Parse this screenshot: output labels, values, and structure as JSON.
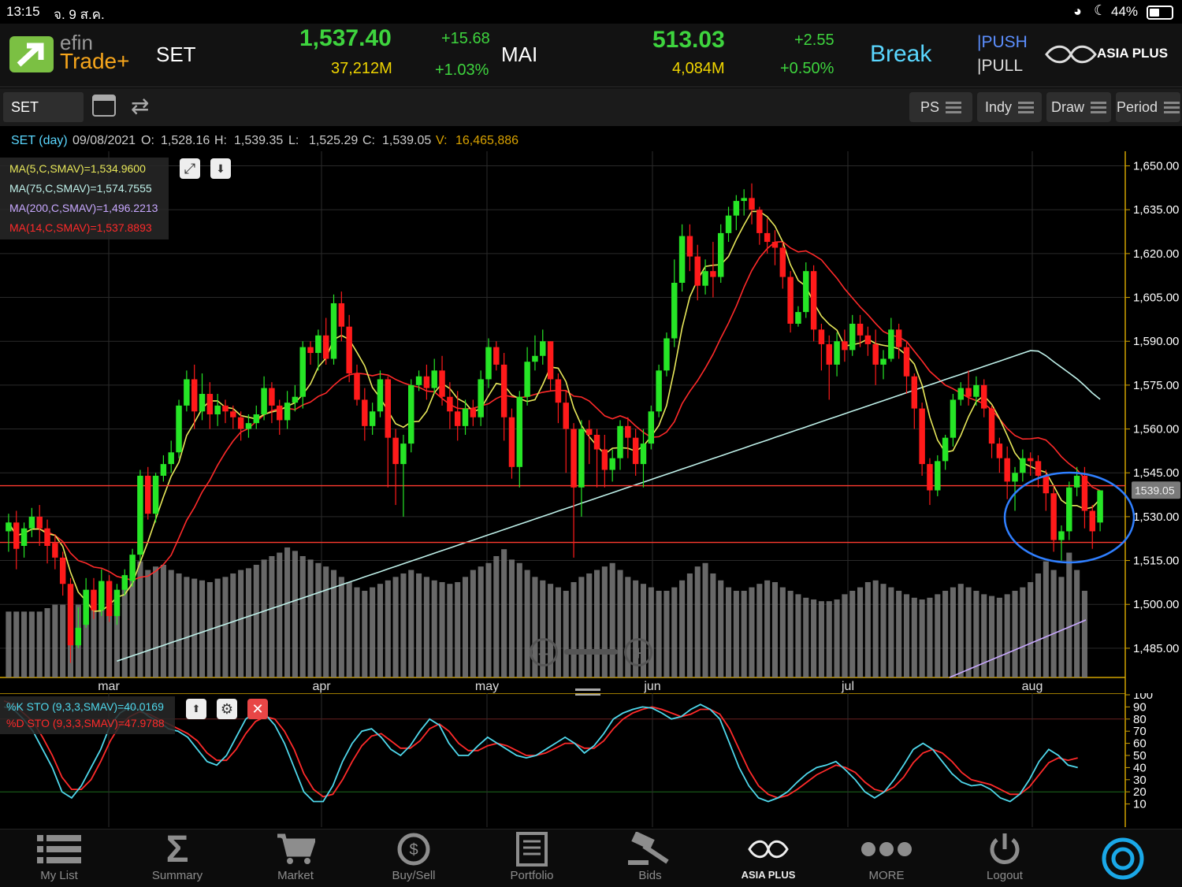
{
  "status_bar": {
    "time": "13:15",
    "date": "จ. 9 ส.ค.",
    "battery": "44%"
  },
  "header": {
    "app_name_line1": "efin",
    "app_name_line2": "Trade+",
    "set": {
      "label": "SET",
      "value": "1,537.40",
      "volume": "37,212M",
      "change": "+15.68",
      "change_pct": "+1.03%"
    },
    "mai": {
      "label": "MAI",
      "value": "513.03",
      "volume": "4,084M",
      "change": "+2.55",
      "change_pct": "+0.50%"
    },
    "break_label": "Break",
    "push_label": "PUSH",
    "pull_label": "PULL",
    "broker_logo": "ASIA PLUS"
  },
  "toolbar": {
    "symbol": "SET",
    "buttons": {
      "ps": "PS",
      "indy": "Indy",
      "draw": "Draw",
      "period": "Period"
    }
  },
  "info_line": {
    "symbol": "SET (day)",
    "date": "09/08/2021",
    "open_label": "O:",
    "open": "1,528.16",
    "high_label": "H:",
    "high": "1,539.35",
    "low_label": "L:",
    "low": "1,525.29",
    "close_label": "C:",
    "close": "1,539.05",
    "vol_label": "V:",
    "volume": "16,465,886"
  },
  "legend": {
    "ma5": "MA(5,C,SMAV)=1,534.9600",
    "ma75": "MA(75,C,SMAV)=1,574.7555",
    "ma200": "MA(200,C,SMAV)=1,496.2213",
    "ma14": "MA(14,C,SMAV)=1,537.8893"
  },
  "sto_legend": {
    "k": "%K STO (9,3,3,SMAV)=40.0169",
    "d": "%D STO (9,3,3,SMAV)=47.9788"
  },
  "colors": {
    "up": "#26e526",
    "down": "#ff1a1a",
    "ma5": "#e8e85a",
    "ma14": "#ff2a2a",
    "ma75": "#bff1ea",
    "ma200": "#c8a8ff",
    "k": "#4fd8ec",
    "d": "#ff2a2a",
    "volume": "#7a7a7a",
    "axis": "#d1a300"
  },
  "chart_data": {
    "type": "candlestick",
    "last_price_tag": "1539.05",
    "y_ticks": [
      "1,650.00",
      "1,635.00",
      "1,620.00",
      "1,605.00",
      "1,590.00",
      "1,575.00",
      "1,560.00",
      "1,545.00",
      "1,530.00",
      "1,515.00",
      "1,500.00",
      "1,485.00"
    ],
    "y_range": [
      1475,
      1655
    ],
    "x_labels": [
      "mar",
      "apr",
      "may",
      "jun",
      "jul",
      "aug"
    ],
    "horizontal_lines": [
      1540.6,
      1521.2
    ],
    "candles": [
      [
        1525,
        1528,
        1518,
        1531
      ],
      [
        1528,
        1519,
        1512,
        1532
      ],
      [
        1520,
        1526,
        1516,
        1528
      ],
      [
        1526,
        1530,
        1523,
        1533
      ],
      [
        1530,
        1526,
        1520,
        1534
      ],
      [
        1526,
        1520,
        1514,
        1529
      ],
      [
        1521,
        1516,
        1512,
        1524
      ],
      [
        1516,
        1507,
        1503,
        1518
      ],
      [
        1507,
        1486,
        1480,
        1509
      ],
      [
        1486,
        1492,
        1485,
        1499
      ],
      [
        1493,
        1505,
        1492,
        1509
      ],
      [
        1505,
        1498,
        1495,
        1509
      ],
      [
        1498,
        1508,
        1496,
        1512
      ],
      [
        1508,
        1496,
        1494,
        1510
      ],
      [
        1496,
        1505,
        1493,
        1507
      ],
      [
        1505,
        1510,
        1503,
        1512
      ],
      [
        1508,
        1517,
        1506,
        1519
      ],
      [
        1517,
        1544,
        1515,
        1546
      ],
      [
        1544,
        1531,
        1529,
        1547
      ],
      [
        1531,
        1544,
        1528,
        1545
      ],
      [
        1544,
        1548,
        1542,
        1551
      ],
      [
        1548,
        1552,
        1545,
        1556
      ],
      [
        1552,
        1568,
        1550,
        1570
      ],
      [
        1568,
        1577,
        1566,
        1580
      ],
      [
        1577,
        1566,
        1560,
        1582
      ],
      [
        1566,
        1572,
        1563,
        1579
      ],
      [
        1572,
        1565,
        1560,
        1576
      ],
      [
        1565,
        1568,
        1561,
        1572
      ],
      [
        1568,
        1566,
        1562,
        1570
      ],
      [
        1566,
        1564,
        1560,
        1568
      ],
      [
        1564,
        1560,
        1556,
        1566
      ],
      [
        1560,
        1562,
        1557,
        1565
      ],
      [
        1562,
        1565,
        1560,
        1568
      ],
      [
        1565,
        1574,
        1563,
        1578
      ],
      [
        1574,
        1568,
        1562,
        1576
      ],
      [
        1568,
        1563,
        1558,
        1570
      ],
      [
        1563,
        1569,
        1560,
        1573
      ],
      [
        1569,
        1571,
        1566,
        1575
      ],
      [
        1571,
        1588,
        1567,
        1590
      ],
      [
        1588,
        1586,
        1582,
        1590
      ],
      [
        1586,
        1592,
        1580,
        1594
      ],
      [
        1592,
        1584,
        1582,
        1598
      ],
      [
        1584,
        1603,
        1582,
        1606
      ],
      [
        1603,
        1595,
        1590,
        1607
      ],
      [
        1595,
        1579,
        1576,
        1599
      ],
      [
        1579,
        1570,
        1568,
        1582
      ],
      [
        1570,
        1561,
        1556,
        1574
      ],
      [
        1561,
        1566,
        1558,
        1569
      ],
      [
        1566,
        1577,
        1564,
        1580
      ],
      [
        1577,
        1557,
        1540,
        1578
      ],
      [
        1557,
        1548,
        1534,
        1560
      ],
      [
        1548,
        1555,
        1530,
        1558
      ],
      [
        1555,
        1575,
        1552,
        1577
      ],
      [
        1575,
        1578,
        1573,
        1580
      ],
      [
        1578,
        1574,
        1570,
        1582
      ],
      [
        1574,
        1580,
        1572,
        1584
      ],
      [
        1580,
        1571,
        1568,
        1585
      ],
      [
        1571,
        1566,
        1560,
        1576
      ],
      [
        1566,
        1561,
        1556,
        1573
      ],
      [
        1561,
        1567,
        1558,
        1570
      ],
      [
        1567,
        1564,
        1561,
        1570
      ],
      [
        1564,
        1577,
        1561,
        1580
      ],
      [
        1577,
        1588,
        1574,
        1591
      ],
      [
        1588,
        1582,
        1580,
        1590
      ],
      [
        1582,
        1564,
        1556,
        1586
      ],
      [
        1564,
        1547,
        1543,
        1567
      ],
      [
        1547,
        1571,
        1540,
        1573
      ],
      [
        1571,
        1583,
        1568,
        1588
      ],
      [
        1583,
        1585,
        1580,
        1592
      ],
      [
        1585,
        1590,
        1582,
        1594
      ],
      [
        1590,
        1577,
        1573,
        1590
      ],
      [
        1577,
        1569,
        1562,
        1579
      ],
      [
        1569,
        1560,
        1545,
        1573
      ],
      [
        1560,
        1540,
        1516,
        1562
      ],
      [
        1540,
        1560,
        1530,
        1563
      ],
      [
        1560,
        1558,
        1548,
        1563
      ],
      [
        1558,
        1553,
        1540,
        1560
      ],
      [
        1553,
        1546,
        1540,
        1558
      ],
      [
        1546,
        1550,
        1542,
        1553
      ],
      [
        1550,
        1561,
        1546,
        1563
      ],
      [
        1561,
        1557,
        1550,
        1564
      ],
      [
        1557,
        1548,
        1544,
        1560
      ],
      [
        1548,
        1555,
        1540,
        1560
      ],
      [
        1555,
        1566,
        1553,
        1568
      ],
      [
        1566,
        1580,
        1564,
        1582
      ],
      [
        1580,
        1591,
        1578,
        1593
      ],
      [
        1591,
        1610,
        1588,
        1618
      ],
      [
        1610,
        1626,
        1607,
        1630
      ],
      [
        1626,
        1619,
        1614,
        1630
      ],
      [
        1619,
        1609,
        1604,
        1623
      ],
      [
        1609,
        1614,
        1606,
        1618
      ],
      [
        1614,
        1612,
        1605,
        1624
      ],
      [
        1612,
        1627,
        1610,
        1630
      ],
      [
        1627,
        1633,
        1624,
        1636
      ],
      [
        1633,
        1638,
        1628,
        1640
      ],
      [
        1638,
        1639,
        1633,
        1642
      ],
      [
        1639,
        1635,
        1630,
        1644
      ],
      [
        1635,
        1627,
        1623,
        1636
      ],
      [
        1627,
        1624,
        1620,
        1632
      ],
      [
        1624,
        1622,
        1616,
        1628
      ],
      [
        1622,
        1612,
        1608,
        1624
      ],
      [
        1612,
        1596,
        1593,
        1614
      ],
      [
        1596,
        1600,
        1595,
        1602
      ],
      [
        1600,
        1614,
        1598,
        1617
      ],
      [
        1614,
        1594,
        1590,
        1616
      ],
      [
        1594,
        1589,
        1580,
        1596
      ],
      [
        1589,
        1582,
        1570,
        1592
      ],
      [
        1582,
        1590,
        1578,
        1593
      ],
      [
        1590,
        1587,
        1583,
        1594
      ],
      [
        1587,
        1596,
        1585,
        1599
      ],
      [
        1596,
        1592,
        1588,
        1599
      ],
      [
        1592,
        1589,
        1585,
        1595
      ],
      [
        1589,
        1582,
        1575,
        1594
      ],
      [
        1582,
        1584,
        1577,
        1587
      ],
      [
        1584,
        1594,
        1583,
        1598
      ],
      [
        1594,
        1588,
        1584,
        1596
      ],
      [
        1588,
        1578,
        1572,
        1590
      ],
      [
        1578,
        1567,
        1560,
        1579
      ],
      [
        1567,
        1548,
        1544,
        1569
      ],
      [
        1548,
        1539,
        1534,
        1550
      ],
      [
        1539,
        1549,
        1537,
        1551
      ],
      [
        1549,
        1557,
        1546,
        1558
      ],
      [
        1557,
        1570,
        1554,
        1572
      ],
      [
        1570,
        1574,
        1568,
        1576
      ],
      [
        1574,
        1571,
        1568,
        1580
      ],
      [
        1571,
        1575,
        1568,
        1578
      ],
      [
        1575,
        1567,
        1564,
        1577
      ],
      [
        1567,
        1555,
        1550,
        1568
      ],
      [
        1555,
        1550,
        1545,
        1557
      ],
      [
        1550,
        1542,
        1536,
        1554
      ],
      [
        1542,
        1545,
        1532,
        1547
      ],
      [
        1545,
        1550,
        1542,
        1553
      ],
      [
        1550,
        1549,
        1544,
        1552
      ],
      [
        1549,
        1544,
        1540,
        1551
      ],
      [
        1544,
        1538,
        1532,
        1546
      ],
      [
        1538,
        1522,
        1518,
        1540
      ],
      [
        1522,
        1525,
        1515,
        1527
      ],
      [
        1525,
        1540,
        1522,
        1542
      ],
      [
        1540,
        1544,
        1537,
        1547
      ],
      [
        1544,
        1532,
        1526,
        1547
      ],
      [
        1532,
        1525,
        1519,
        1534
      ],
      [
        1528,
        1539,
        1525,
        1539
      ]
    ],
    "volume_scale": [
      0,
      100
    ],
    "volumes": [
      38,
      38,
      38,
      38,
      38,
      40,
      42,
      42,
      40,
      42,
      45,
      48,
      50,
      48,
      50,
      52,
      60,
      67,
      62,
      64,
      65,
      62,
      60,
      58,
      57,
      56,
      55,
      57,
      58,
      60,
      62,
      63,
      65,
      68,
      70,
      72,
      75,
      73,
      70,
      68,
      66,
      64,
      62,
      58,
      55,
      52,
      50,
      52,
      54,
      56,
      58,
      60,
      62,
      60,
      58,
      56,
      55,
      54,
      55,
      58,
      62,
      64,
      66,
      70,
      74,
      68,
      66,
      62,
      58,
      56,
      54,
      52,
      50,
      55,
      58,
      60,
      62,
      64,
      66,
      62,
      58,
      56,
      54,
      52,
      50,
      50,
      52,
      56,
      60,
      64,
      66,
      60,
      56,
      52,
      50,
      50,
      52,
      54,
      56,
      55,
      52,
      50,
      48,
      46,
      45,
      44,
      44,
      45,
      48,
      50,
      52,
      55,
      56,
      54,
      52,
      50,
      48,
      46,
      45,
      46,
      48,
      50,
      52,
      54,
      52,
      50,
      48,
      47,
      46,
      48,
      50,
      52,
      55,
      60,
      67,
      62,
      58,
      72,
      62,
      50
    ],
    "stochastic": {
      "y_ticks": [
        "100",
        "90",
        "80",
        "70",
        "60",
        "50",
        "40",
        "30",
        "20",
        "10"
      ],
      "k": [
        90,
        88,
        80,
        70,
        55,
        40,
        20,
        15,
        25,
        40,
        55,
        75,
        85,
        90,
        88,
        82,
        78,
        72,
        70,
        65,
        55,
        45,
        42,
        50,
        65,
        80,
        86,
        84,
        75,
        60,
        40,
        20,
        12,
        12,
        25,
        45,
        60,
        70,
        72,
        65,
        55,
        50,
        58,
        70,
        80,
        75,
        60,
        50,
        50,
        58,
        65,
        60,
        55,
        50,
        48,
        50,
        55,
        60,
        65,
        60,
        52,
        58,
        68,
        80,
        85,
        88,
        90,
        89,
        85,
        80,
        82,
        88,
        92,
        88,
        80,
        60,
        40,
        25,
        15,
        12,
        15,
        20,
        28,
        35,
        40,
        42,
        45,
        38,
        30,
        20,
        15,
        20,
        30,
        42,
        55,
        60,
        55,
        45,
        35,
        28,
        25,
        26,
        22,
        15,
        12,
        18,
        30,
        45,
        55,
        50,
        42,
        40
      ],
      "d": [
        95,
        92,
        85,
        78,
        65,
        50,
        32,
        22,
        22,
        30,
        45,
        62,
        75,
        82,
        86,
        84,
        80,
        76,
        72,
        68,
        62,
        52,
        46,
        46,
        55,
        68,
        78,
        82,
        80,
        70,
        55,
        35,
        22,
        16,
        18,
        30,
        45,
        58,
        66,
        68,
        62,
        56,
        56,
        62,
        72,
        76,
        70,
        60,
        54,
        54,
        58,
        60,
        58,
        54,
        50,
        50,
        52,
        56,
        60,
        60,
        56,
        56,
        62,
        72,
        80,
        85,
        88,
        90,
        88,
        85,
        82,
        84,
        88,
        88,
        84,
        72,
        55,
        38,
        25,
        18,
        15,
        17,
        22,
        28,
        34,
        38,
        42,
        40,
        36,
        28,
        22,
        20,
        24,
        32,
        44,
        52,
        55,
        52,
        45,
        36,
        30,
        28,
        26,
        22,
        18,
        18,
        24,
        34,
        44,
        48,
        46,
        48
      ]
    }
  },
  "bottom_nav": [
    {
      "label": "My List",
      "icon": "list-icon"
    },
    {
      "label": "Summary",
      "icon": "sigma-icon"
    },
    {
      "label": "Market",
      "icon": "cart-icon"
    },
    {
      "label": "Buy/Sell",
      "icon": "buysell-icon"
    },
    {
      "label": "Portfolio",
      "icon": "portfolio-icon"
    },
    {
      "label": "Bids",
      "icon": "gavel-icon"
    },
    {
      "label": "ASIA PLUS",
      "icon": "asiaplus-icon"
    },
    {
      "label": "MORE",
      "icon": "more-icon"
    },
    {
      "label": "Logout",
      "icon": "power-icon"
    }
  ]
}
